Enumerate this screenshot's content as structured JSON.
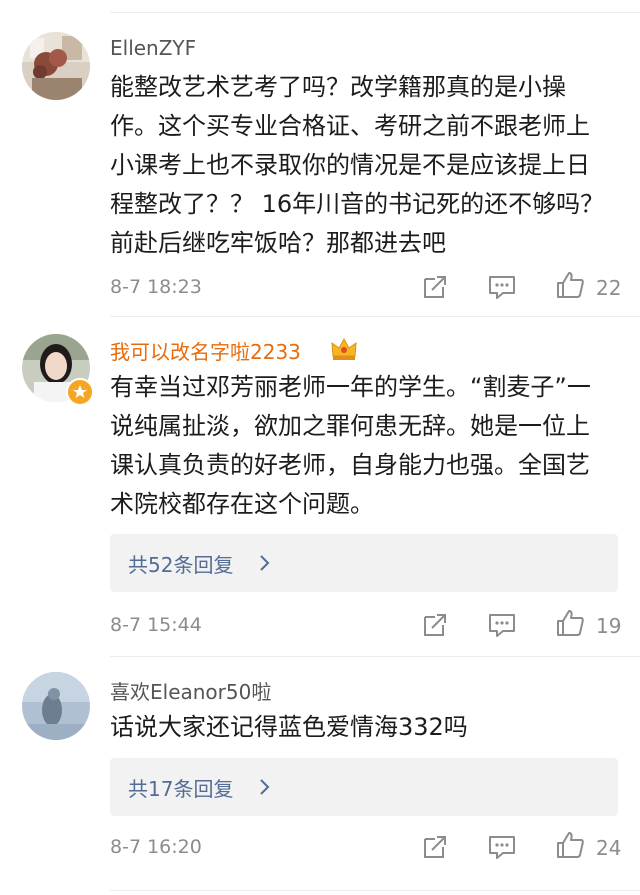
{
  "comments": [
    {
      "username": "EllenZYF",
      "text": "能整改艺术艺考了吗？改学籍那真的是小操作。这个买专业合格证、考研之前不跟老师上小课考上也不录取你的情况是不是应该提上日程整改了？？ 16年川音的书记死的还不够吗？前赴后继吃牢饭哈？那都进去吧",
      "time": "8-7 18:23",
      "likes": "22"
    },
    {
      "username": "我可以改名字啦2233",
      "text": "有幸当过邓芳丽老师一年的学生。“割麦子”一说纯属扯淡，欲加之罪何患无辞。她是一位上课认真负责的好老师，自身能力也强。全国艺术院校都存在这个问题。",
      "replies": "共52条回复",
      "time": "8-7 15:44",
      "likes": "19"
    },
    {
      "username": "喜欢Eleanor50啦",
      "text": "话说大家还记得蓝色爱情海332吗",
      "replies": "共17条回复",
      "time": "8-7 16:20",
      "likes": "24"
    }
  ],
  "colors": {
    "vip_name": "#e86b0c",
    "reply_link": "#526c96",
    "meta": "#8c8c8c"
  },
  "icons": [
    "share-icon",
    "comment-icon",
    "like-icon",
    "chevron-right-icon",
    "crown-icon",
    "verified-badge-icon"
  ]
}
